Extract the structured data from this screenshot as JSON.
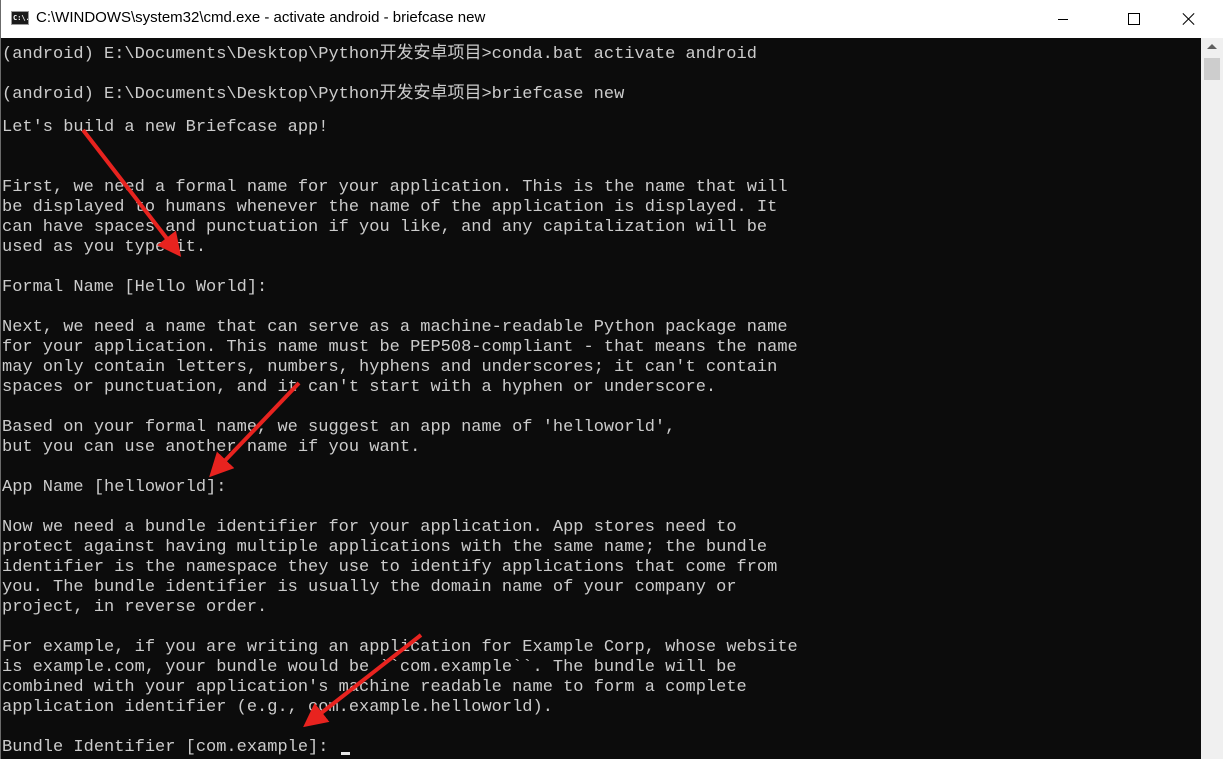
{
  "window": {
    "title": "C:\\WINDOWS\\system32\\cmd.exe - activate  android - briefcase  new",
    "icon_label": "C:\\."
  },
  "console": {
    "lines": [
      "(android) E:\\Documents\\Desktop\\Python开发安卓项目>conda.bat activate android",
      "",
      "(android) E:\\Documents\\Desktop\\Python开发安卓项目>briefcase new",
      "",
      "Let's build a new Briefcase app!",
      "",
      "",
      "First, we need a formal name for your application. This is the name that will",
      "be displayed to humans whenever the name of the application is displayed. It",
      "can have spaces and punctuation if you like, and any capitalization will be",
      "used as you type it.",
      "",
      "Formal Name [Hello World]:",
      "",
      "Next, we need a name that can serve as a machine-readable Python package name",
      "for your application. This name must be PEP508-compliant - that means the name",
      "may only contain letters, numbers, hyphens and underscores; it can't contain",
      "spaces or punctuation, and it can't start with a hyphen or underscore.",
      "",
      "Based on your formal name, we suggest an app name of 'helloworld',",
      "but you can use another name if you want.",
      "",
      "App Name [helloworld]:",
      "",
      "Now we need a bundle identifier for your application. App stores need to",
      "protect against having multiple applications with the same name; the bundle",
      "identifier is the namespace they use to identify applications that come from",
      "you. The bundle identifier is usually the domain name of your company or",
      "project, in reverse order.",
      "",
      "For example, if you are writing an application for Example Corp, whose website",
      "is example.com, your bundle would be ``com.example``. The bundle will be",
      "combined with your application's machine readable name to form a complete",
      "application identifier (e.g., com.example.helloworld).",
      "",
      "Bundle Identifier [com.example]: "
    ]
  },
  "colors": {
    "console_bg": "#0c0c0c",
    "console_text": "#cccccc",
    "annotation_arrow": "#e8231f"
  },
  "icons": [
    "cmd-app-icon",
    "minimize-icon",
    "maximize-icon",
    "close-icon",
    "scroll-up-arrow-icon"
  ]
}
